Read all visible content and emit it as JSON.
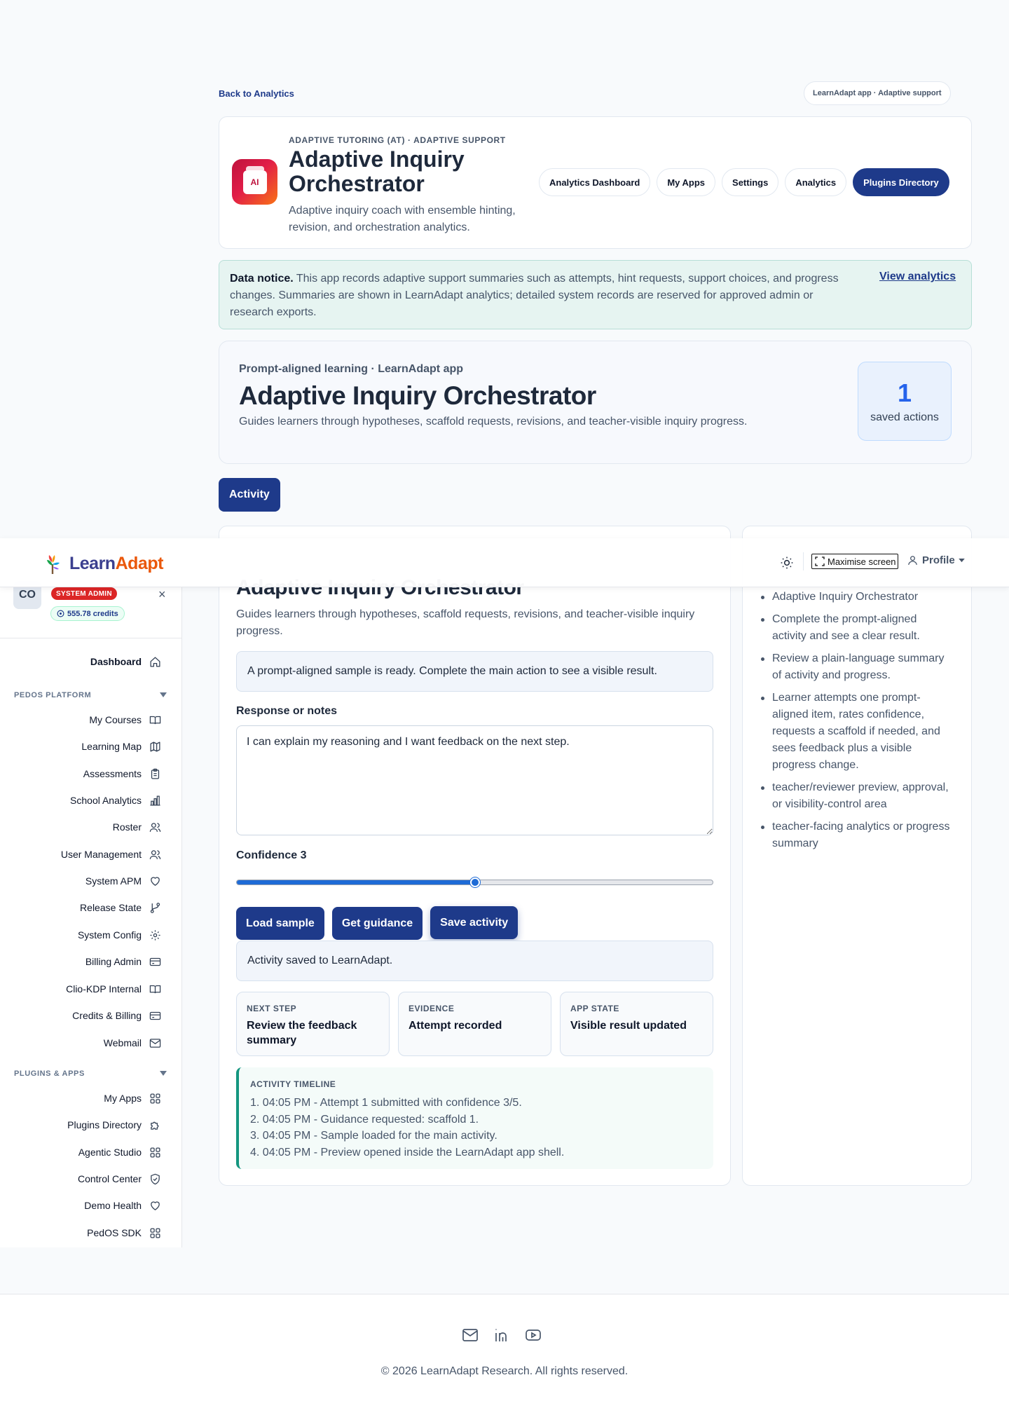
{
  "page": {
    "back_link": "Back to Analytics",
    "app_pill": "LearnAdapt app · Adaptive support"
  },
  "header": {
    "logo_text": "AI",
    "eyebrow": "ADAPTIVE TUTORING (AT) · ADAPTIVE SUPPORT",
    "title": "Adaptive Inquiry Orchestrator",
    "description": "Adaptive inquiry coach with ensemble hinting, revision, and orchestration analytics.",
    "nav": [
      {
        "label": "Analytics Dashboard"
      },
      {
        "label": "My Apps"
      },
      {
        "label": "Settings"
      },
      {
        "label": "Analytics"
      },
      {
        "label": "Plugins Directory"
      }
    ]
  },
  "notice": {
    "lead": "Data notice.",
    "text": " This app records adaptive support summaries such as attempts, hint requests, support choices, and progress changes. Summaries are shown in LearnAdapt analytics; detailed system records are reserved for approved admin or research exports.",
    "link": "View analytics"
  },
  "hero": {
    "eyebrow": "Prompt-aligned learning · LearnAdapt app",
    "title": "Adaptive Inquiry Orchestrator",
    "description": "Guides learners through hypotheses, scaffold requests, revisions, and teacher-visible inquiry progress.",
    "saved_count": "1",
    "saved_label": "saved actions"
  },
  "tabs": {
    "activity": "Activity"
  },
  "activity": {
    "title": "Adaptive Inquiry Orchestrator",
    "description": "Guides learners through hypotheses, scaffold requests, revisions, and teacher-visible inquiry progress.",
    "info": "A prompt-aligned sample is ready. Complete the main action to see a visible result.",
    "response_label": "Response or notes",
    "response_value": "I can explain my reasoning and I want feedback on the next step.",
    "confidence_label": "Confidence 3",
    "confidence_value": 3,
    "confidence_min": 1,
    "confidence_max": 5,
    "buttons": {
      "load": "Load sample",
      "guidance": "Get guidance",
      "save": "Save activity"
    },
    "status": "Activity saved to LearnAdapt.",
    "stats": [
      {
        "key": "NEXT STEP",
        "value": "Review the feedback summary"
      },
      {
        "key": "EVIDENCE",
        "value": "Attempt recorded"
      },
      {
        "key": "APP STATE",
        "value": "Visible result updated"
      }
    ],
    "timeline_title": "ACTIVITY TIMELINE",
    "timeline": [
      "1. 04:05 PM - Attempt 1 submitted with confidence 3/5.",
      "2. 04:05 PM - Guidance requested: scaffold 1.",
      "3. 04:05 PM - Sample loaded for the main activity.",
      "4. 04:05 PM - Preview opened inside the LearnAdapt app shell."
    ]
  },
  "right_panel": {
    "items": [
      "Adaptive Inquiry Orchestrator",
      "Complete the prompt-aligned activity and see a clear result.",
      "Review a plain-language summary of activity and progress.",
      "Learner attempts one prompt-aligned item, rates confidence, requests a scaffold if needed, and sees feedback plus a visible progress change.",
      "teacher/reviewer preview, approval, or visibility-control area",
      "teacher-facing analytics or progress summary"
    ]
  },
  "topbar": {
    "brand_part1": "Learn",
    "brand_part2": "Adapt",
    "maximise": "Maximise screen",
    "profile": "Profile"
  },
  "sidebar": {
    "avatar": "CO",
    "role": "SYSTEM ADMIN",
    "credits": "555.78 credits",
    "close": "×",
    "dashboard": "Dashboard",
    "section1": "PEDOS PLATFORM",
    "platform_items": [
      "My Courses",
      "Learning Map",
      "Assessments",
      "School Analytics",
      "Roster",
      "User Management",
      "System APM",
      "Release State",
      "System Config",
      "Billing Admin",
      "Clio-KDP Internal",
      "Credits & Billing",
      "Webmail"
    ],
    "section2": "PLUGINS & APPS",
    "plugin_items": [
      "My Apps",
      "Plugins Directory",
      "Agentic Studio",
      "Control Center",
      "Demo Health",
      "PedOS SDK"
    ]
  },
  "footer": {
    "copyright": "© 2026 LearnAdapt Research. All rights reserved."
  },
  "colors": {
    "primary": "#1e3a8a",
    "accent_blue": "#2563eb",
    "badge_red": "#dc2626",
    "timeline_green": "#14967f",
    "brand_orange": "#ea580c"
  }
}
